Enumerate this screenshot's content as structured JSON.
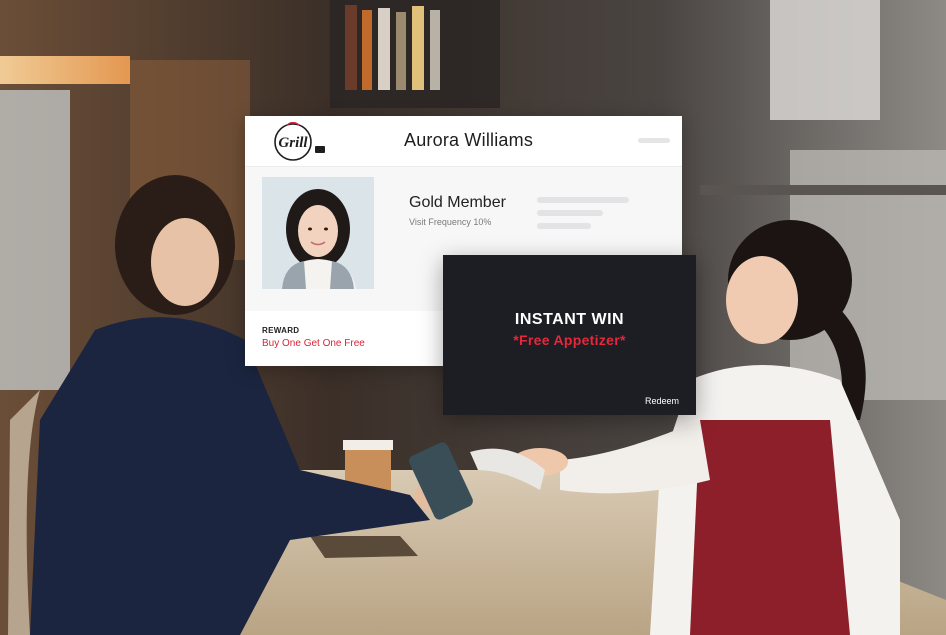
{
  "profile_card": {
    "brand_logo_text": "Grill",
    "customer_name": "Aurora Williams",
    "tier": "Gold Member",
    "visit_frequency": "Visit Frequency 10%",
    "reward_heading": "REWARD",
    "reward_offer": "Buy One Get One Free"
  },
  "instant_win": {
    "title": "INSTANT WIN",
    "prize": "*Free Appetizer*",
    "redeem_label": "Redeem"
  },
  "colors": {
    "accent_red": "#d6263b",
    "popup_background": "#1c1e24"
  }
}
